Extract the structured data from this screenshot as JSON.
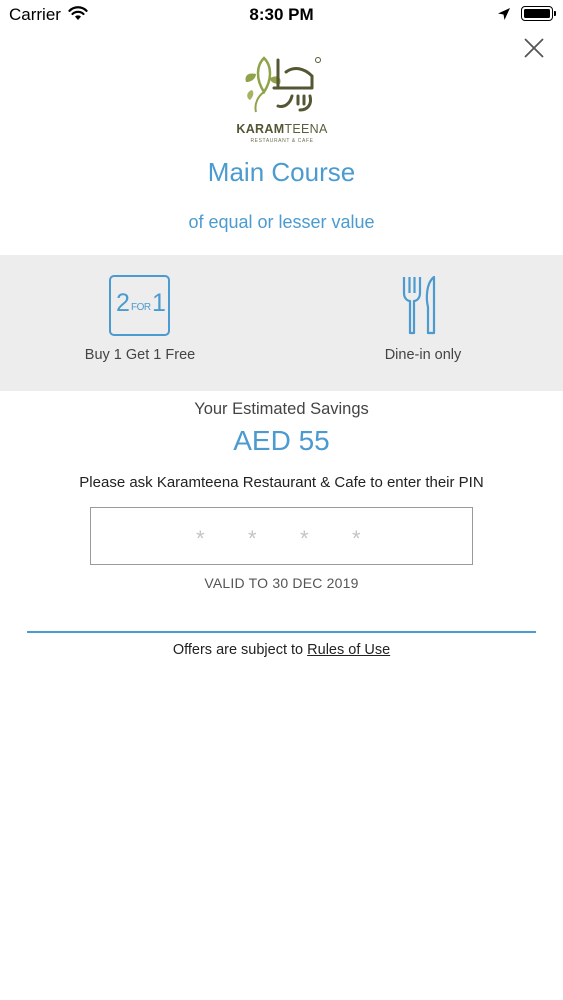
{
  "status_bar": {
    "carrier": "Carrier",
    "time": "8:30 PM"
  },
  "logo": {
    "name_bold": "KARAM",
    "name_rest": "TEENA",
    "subtitle": "RESTAURANT & CAFE",
    "colors": {
      "green": "#5b5e3a",
      "leaf": "#8fa34a"
    }
  },
  "offer": {
    "title": "Main Course",
    "subtitle": "of equal or lesser value"
  },
  "features": [
    {
      "icon": "2-for-1-icon",
      "icon_text": {
        "two": "2",
        "for": "FOR",
        "one": "1"
      },
      "label": "Buy 1 Get 1 Free"
    },
    {
      "icon": "fork-knife-icon",
      "label": "Dine-in only"
    }
  ],
  "savings": {
    "label": "Your Estimated Savings",
    "amount": "AED 55"
  },
  "pin": {
    "prompt": "Please ask Karamteena Restaurant & Cafe to enter their PIN",
    "placeholder": [
      "*",
      "*",
      "*",
      "*"
    ]
  },
  "validity": "VALID TO 30 DEC 2019",
  "footer": {
    "prefix": "Offers are subject to ",
    "link": "Rules of Use"
  },
  "colors": {
    "accent": "#4b9bd0",
    "band": "#ededed"
  }
}
